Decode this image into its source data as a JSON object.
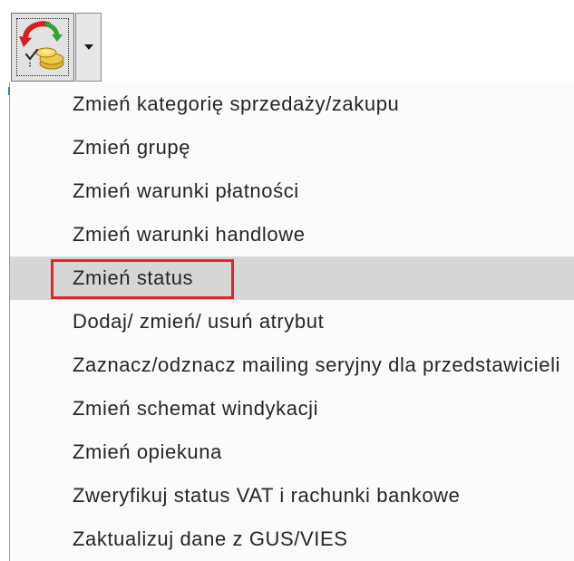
{
  "toolbar": {
    "action_button": {
      "icon": "change-status-coins-icon"
    },
    "dropdown_button": {
      "icon": "chevron-down-icon"
    }
  },
  "menu": {
    "hovered_index": 4,
    "annotated_index": 4,
    "items": [
      {
        "label": "Zmień kategorię sprzedaży/zakupu"
      },
      {
        "label": "Zmień grupę"
      },
      {
        "label": "Zmień warunki płatności"
      },
      {
        "label": "Zmień warunki handlowe"
      },
      {
        "label": "Zmień status"
      },
      {
        "label": "Dodaj/ zmień/ usuń atrybut"
      },
      {
        "label": "Zaznacz/odznacz mailing seryjny dla przedstawicieli"
      },
      {
        "label": "Zmień schemat windykacji"
      },
      {
        "label": "Zmień opiekuna"
      },
      {
        "label": "Zweryfikuj status VAT i rachunki bankowe"
      },
      {
        "label": "Zaktualizuj dane z GUS/VIES"
      }
    ]
  },
  "colors": {
    "hover_background": "#d6d6d6",
    "annotation_border": "#e3262e",
    "text": "#262626"
  }
}
